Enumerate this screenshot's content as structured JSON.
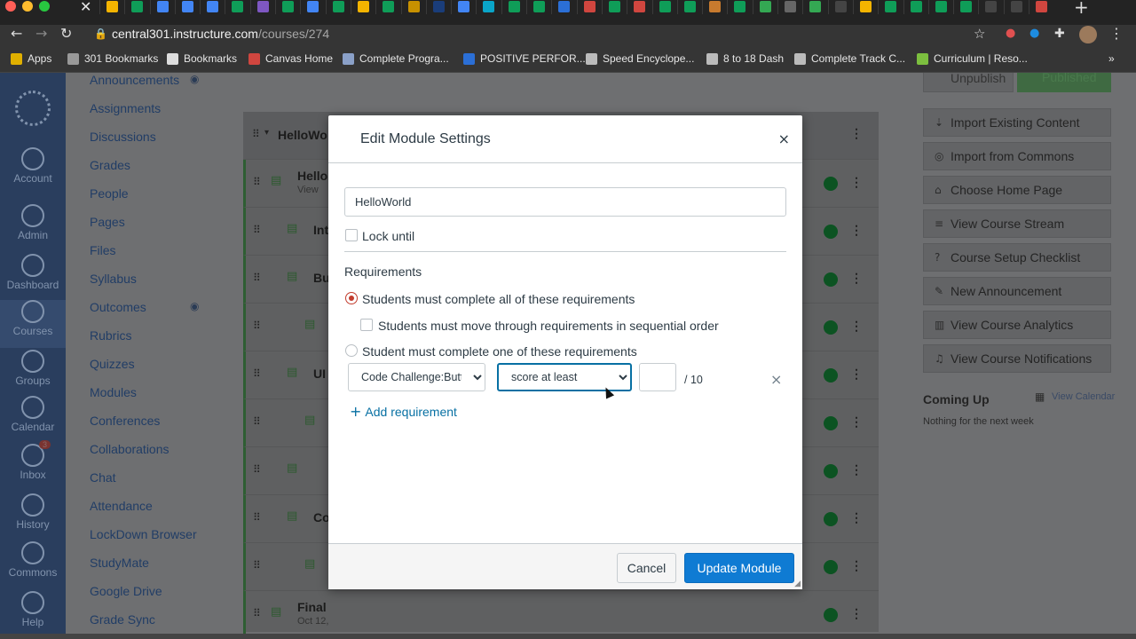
{
  "browser": {
    "url_host": "central301.instructure.com",
    "url_path": "/courses/274",
    "bookmarks": [
      {
        "label": "Apps",
        "color": "#e0b000"
      },
      {
        "label": "301 Bookmarks",
        "color": "#999999"
      },
      {
        "label": "Bookmarks",
        "color": "#dddddd"
      },
      {
        "label": "Canvas Home",
        "color": "#d0463f"
      },
      {
        "label": "Complete Progra...",
        "color": "#8aa0c8"
      },
      {
        "label": "POSITIVE PERFOR...",
        "color": "#2b6fd6"
      },
      {
        "label": "Speed Encyclope...",
        "color": "#bbbbbb"
      },
      {
        "label": "8 to 18 Dash",
        "color": "#bbbbbb"
      },
      {
        "label": "Complete Track C...",
        "color": "#bbbbbb"
      },
      {
        "label": "Curriculum | Reso...",
        "color": "#7cbf3f"
      }
    ],
    "more_bookmarks_glyph": "»",
    "tab_colors": [
      "#f4b400",
      "#0f9d58",
      "#4285f4",
      "#4285f4",
      "#4285f4",
      "#0f9d58",
      "#7e57c2",
      "#0f9d58",
      "#4285f4",
      "#0f9d58",
      "#f4b400",
      "#0f9d58",
      "#c79100",
      "#1a3d7a",
      "#4285f4",
      "#0aa5c8",
      "#0f9d58",
      "#0f9d58",
      "#2b6fd6",
      "#d0463f",
      "#0f9d58",
      "#d0463f",
      "#0f9d58",
      "#0f9d58",
      "#c77a2e",
      "#0f9d58",
      "#34a853",
      "#666666",
      "#34a853",
      "#444444",
      "#f4b400",
      "#0f9d58",
      "#0f9d58",
      "#0f9d58",
      "#0f9d58",
      "#444444",
      "#444444",
      "#d0463f"
    ]
  },
  "global_nav": {
    "items": [
      "Account",
      "Admin",
      "Dashboard",
      "Courses",
      "Groups",
      "Calendar",
      "Inbox",
      "History",
      "Commons",
      "Help"
    ],
    "inbox_badge": "3"
  },
  "course_nav": {
    "items": [
      "Announcements",
      "Assignments",
      "Discussions",
      "Grades",
      "People",
      "Pages",
      "Files",
      "Syllabus",
      "Outcomes",
      "Rubrics",
      "Quizzes",
      "Modules",
      "Conferences",
      "Collaborations",
      "Chat",
      "Attendance",
      "LockDown Browser",
      "StudyMate",
      "Google Drive",
      "Grade Sync"
    ]
  },
  "modules_bg": {
    "module_title": "HelloWo",
    "rows": [
      {
        "title": "Hello",
        "sub": "View"
      },
      {
        "title": "Int",
        "sub": ""
      },
      {
        "title": "Bu",
        "sub": ""
      },
      {
        "title": "",
        "sub": ""
      },
      {
        "title": "UI",
        "sub": ""
      },
      {
        "title": "",
        "sub": ""
      },
      {
        "title": "",
        "sub": ""
      },
      {
        "title": "Co",
        "sub": ""
      },
      {
        "title": "",
        "sub": ""
      },
      {
        "title": "Final",
        "sub": "Oct 12,"
      }
    ]
  },
  "right_sidebar": {
    "unpublish": "Unpublish",
    "published": "Published",
    "buttons": [
      {
        "label": "Import Existing Content",
        "icon": "import-icon"
      },
      {
        "label": "Import from Commons",
        "icon": "commons-icon"
      },
      {
        "label": "Choose Home Page",
        "icon": "home-icon"
      },
      {
        "label": "View Course Stream",
        "icon": "stream-icon"
      },
      {
        "label": "Course Setup Checklist",
        "icon": "checklist-icon"
      },
      {
        "label": "New Announcement",
        "icon": "announcement-icon"
      },
      {
        "label": "View Course Analytics",
        "icon": "analytics-icon"
      },
      {
        "label": "View Course Notifications",
        "icon": "bell-icon"
      }
    ],
    "coming_up": "Coming Up",
    "view_calendar": "View Calendar",
    "nothing": "Nothing for the next week"
  },
  "modal": {
    "title": "Edit Module Settings",
    "close": "×",
    "module_name": "HelloWorld",
    "lock_until": "Lock until",
    "requirements_heading": "Requirements",
    "option_all": "Students must complete all of these requirements",
    "sequential": "Students must move through requirements in sequential order",
    "option_one": "Student must complete one of these requirements",
    "requirement": {
      "item": "Code Challenge:Button",
      "type": "score at least",
      "score": "",
      "max": "/ 10",
      "remove": "×"
    },
    "add_requirement": "Add requirement",
    "cancel": "Cancel",
    "update": "Update Module"
  }
}
